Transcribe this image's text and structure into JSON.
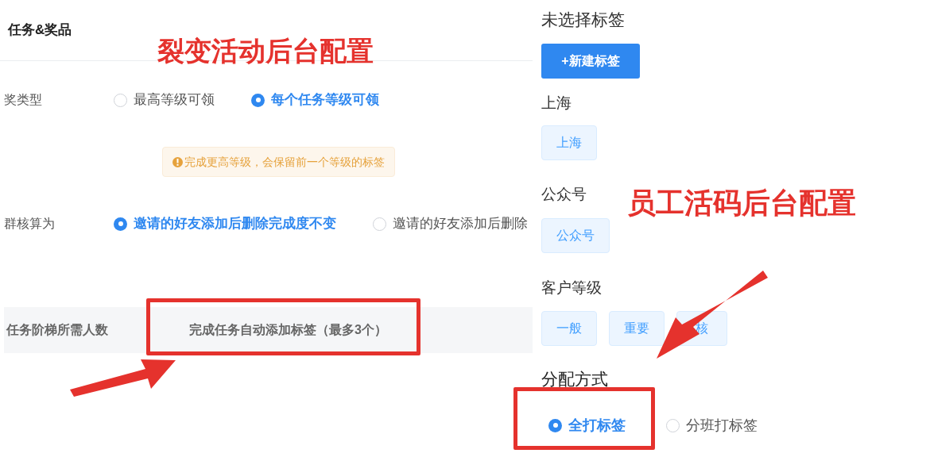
{
  "prize_panel": {
    "title": "任务&奖品",
    "fields": [
      {
        "label": "奖类型",
        "options": [
          {
            "label": "最高等级可领",
            "selected": false
          },
          {
            "label": "每个任务等级可领",
            "selected": true
          }
        ],
        "notice": "完成更高等级，会保留前一个等级的标签"
      },
      {
        "label": "群核算为",
        "options": [
          {
            "label": "邀请的好友添加后删除完成度不变",
            "selected": true
          },
          {
            "label": "邀请的好友添加后删除",
            "selected": false
          }
        ]
      }
    ],
    "table_header": {
      "column_1": "任务阶梯所需人数",
      "column_2": "完成任务自动添加标签（最多3个）"
    }
  },
  "tag_panel": {
    "heading": "未选择标签",
    "new_tag_button": "+新建标签",
    "groups": [
      {
        "name": "上海",
        "tags": [
          "上海"
        ]
      },
      {
        "name": "公众号",
        "tags": [
          "公众号"
        ]
      },
      {
        "name": "客户等级",
        "tags": [
          "一般",
          "重要",
          "核"
        ]
      }
    ],
    "assign": {
      "label": "分配方式",
      "options": [
        {
          "label": "全打标签",
          "selected": true
        },
        {
          "label": "分班打标签",
          "selected": false
        }
      ]
    }
  },
  "annotations": [
    "裂变活动后台配置",
    "员工活码后台配置"
  ]
}
